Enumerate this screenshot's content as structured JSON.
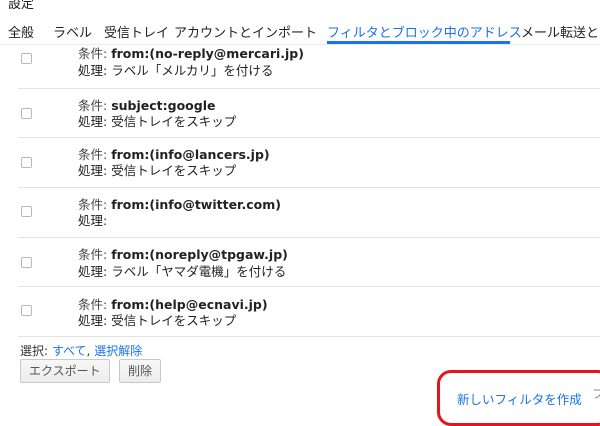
{
  "page_title": "設定",
  "tabs": [
    {
      "label": "全般"
    },
    {
      "label": "ラベル"
    },
    {
      "label": "受信トレイ"
    },
    {
      "label": "アカウントとインポート"
    },
    {
      "label": "フィルタとブロック中のアドレス"
    },
    {
      "label": "メール転送と P"
    }
  ],
  "condition_prefix": "条件: ",
  "action_prefix": "処理: ",
  "filters": [
    {
      "criteria": "from:(no-reply@mercari.jp)",
      "action": "ラベル「メルカリ」を付ける"
    },
    {
      "criteria": "subject:google",
      "action": "受信トレイをスキップ"
    },
    {
      "criteria": "from:(info@lancers.jp)",
      "action": "受信トレイをスキップ"
    },
    {
      "criteria": "from:(info@twitter.com)",
      "action": ""
    },
    {
      "criteria": "from:(noreply@tpgaw.jp)",
      "action": "ラベル「ヤマダ電機」を付ける"
    },
    {
      "criteria": "from:(help@ecnavi.jp)",
      "action": "受信トレイをスキップ"
    }
  ],
  "selection": {
    "label": "選択: ",
    "all": "すべて",
    "separator": ", ",
    "none": "選択解除"
  },
  "buttons": {
    "export": "エクスポート",
    "delete": "削除"
  },
  "create_filter": "新しいフィルタを作成",
  "trailing_char": "フ",
  "colors": {
    "accent": "#1a73e8",
    "highlight": "#e8141c"
  }
}
